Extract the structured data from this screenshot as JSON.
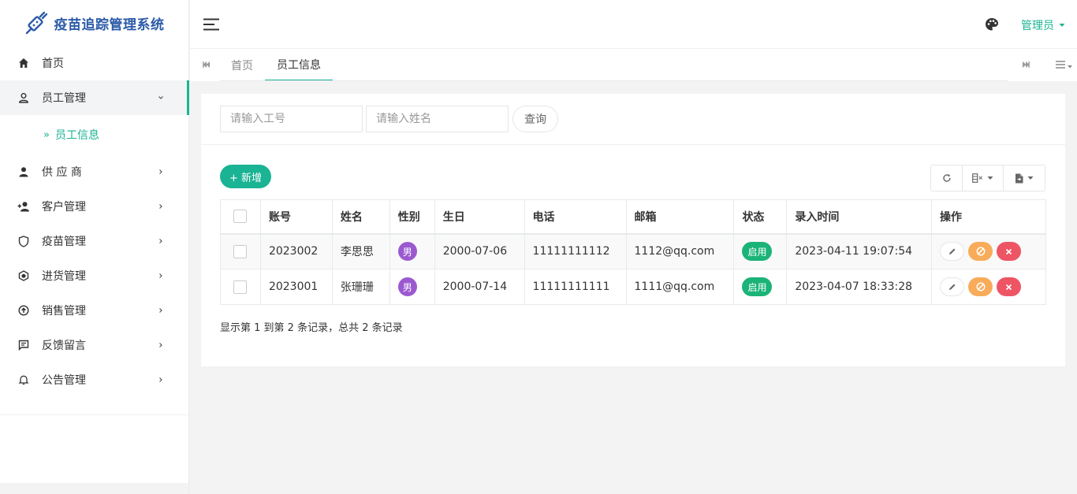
{
  "app": {
    "title": "疫苗追踪管理系统"
  },
  "sidebar": {
    "items": [
      {
        "label": "首页",
        "icon": "home-icon"
      },
      {
        "label": "员工管理",
        "icon": "user-outline-icon",
        "expanded": true
      },
      {
        "label": "供 应 商",
        "icon": "user-solid-icon"
      },
      {
        "label": "客户管理",
        "icon": "user-add-icon"
      },
      {
        "label": "疫苗管理",
        "icon": "shield-icon"
      },
      {
        "label": "进货管理",
        "icon": "box-icon"
      },
      {
        "label": "销售管理",
        "icon": "upload-circle-icon"
      },
      {
        "label": "反馈留言",
        "icon": "message-icon"
      },
      {
        "label": "公告管理",
        "icon": "bell-icon"
      }
    ],
    "subitems": [
      {
        "label": "员工信息"
      }
    ]
  },
  "header": {
    "user": "管理员"
  },
  "tabs": [
    {
      "label": "首页"
    },
    {
      "label": "员工信息",
      "active": true
    }
  ],
  "search": {
    "id_placeholder": "请输入工号",
    "name_placeholder": "请输入姓名",
    "query_label": "查询"
  },
  "toolbar": {
    "add_label": "+ 新增"
  },
  "table": {
    "headers": [
      "账号",
      "姓名",
      "性别",
      "生日",
      "电话",
      "邮箱",
      "状态",
      "录入时间",
      "操作"
    ],
    "rows": [
      {
        "account": "2023002",
        "name": "李思思",
        "gender": "男",
        "birthday": "2000-07-06",
        "phone": "11111111112",
        "email": "1112@qq.com",
        "status": "启用",
        "created": "2023-04-11 19:07:54"
      },
      {
        "account": "2023001",
        "name": "张珊珊",
        "gender": "男",
        "birthday": "2000-07-14",
        "phone": "11111111111",
        "email": "1111@qq.com",
        "status": "启用",
        "created": "2023-04-07 18:33:28"
      }
    ]
  },
  "pagination": {
    "info": "显示第 1 到第 2 条记录，总共 2 条记录"
  },
  "colors": {
    "accent": "#1ab394",
    "brand": "#2b5ba8",
    "status_on": "#1bb378",
    "gender": "#9b59d0",
    "warn": "#f8ac59",
    "danger": "#ed5565"
  }
}
